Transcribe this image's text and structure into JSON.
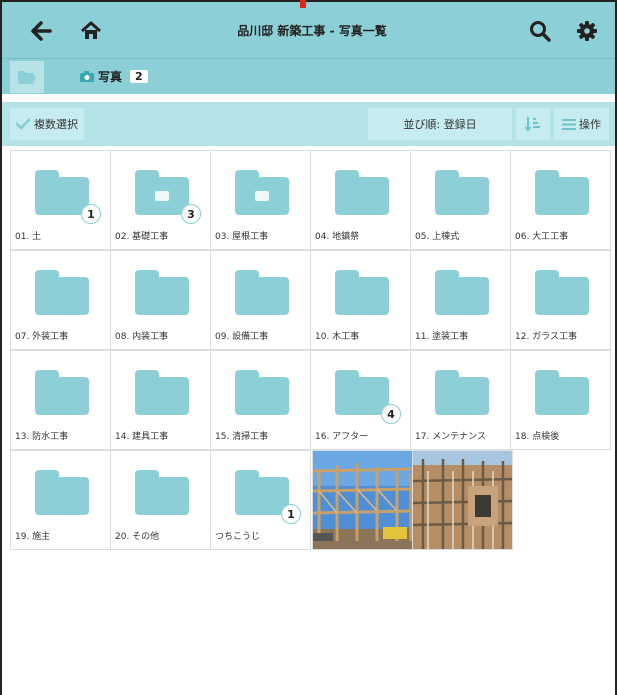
{
  "header": {
    "title": "品川邸 新築工事 - 写真一覧"
  },
  "pathbar": {
    "crumb_label": "写真",
    "crumb_count": "2"
  },
  "toolbar": {
    "multi_select_label": "複数選択",
    "sort_label": "並び順: 登録日",
    "ops_label": "操作"
  },
  "folders": [
    {
      "label": "01. 土",
      "count": "1",
      "doc": false
    },
    {
      "label": "02. 基礎工事",
      "count": "3",
      "doc": true
    },
    {
      "label": "03. 屋根工事",
      "count": "",
      "doc": true
    },
    {
      "label": "04. 地鎮祭",
      "count": "",
      "doc": false
    },
    {
      "label": "05. 上棟式",
      "count": "",
      "doc": false
    },
    {
      "label": "06. 大工工事",
      "count": "",
      "doc": false
    },
    {
      "label": "07. 外装工事",
      "count": "",
      "doc": false
    },
    {
      "label": "08. 内装工事",
      "count": "",
      "doc": false
    },
    {
      "label": "09. 設備工事",
      "count": "",
      "doc": false
    },
    {
      "label": "10. 木工事",
      "count": "",
      "doc": false
    },
    {
      "label": "11. 塗装工事",
      "count": "",
      "doc": false
    },
    {
      "label": "12. ガラス工事",
      "count": "",
      "doc": false
    },
    {
      "label": "13. 防水工事",
      "count": "",
      "doc": false
    },
    {
      "label": "14. 建具工事",
      "count": "",
      "doc": false
    },
    {
      "label": "15. 清掃工事",
      "count": "",
      "doc": false
    },
    {
      "label": "16. アフター",
      "count": "4",
      "doc": false
    },
    {
      "label": "17. メンテナンス",
      "count": "",
      "doc": false
    },
    {
      "label": "18. 点検後",
      "count": "",
      "doc": false
    },
    {
      "label": "19. 施主",
      "count": "",
      "doc": false
    },
    {
      "label": "20. その他",
      "count": "",
      "doc": false
    },
    {
      "label": "つちこうじ",
      "count": "1",
      "doc": false
    }
  ],
  "colors": {
    "accent": "#8ccfd6",
    "toolbar": "#b3e3e7",
    "check": "#8ccfd6"
  },
  "icons": [
    "back-arrow-icon",
    "home-icon",
    "search-icon",
    "gear-icon",
    "folder-open-icon",
    "camera-icon",
    "check-icon",
    "sort-direction-icon",
    "list-menu-icon"
  ]
}
